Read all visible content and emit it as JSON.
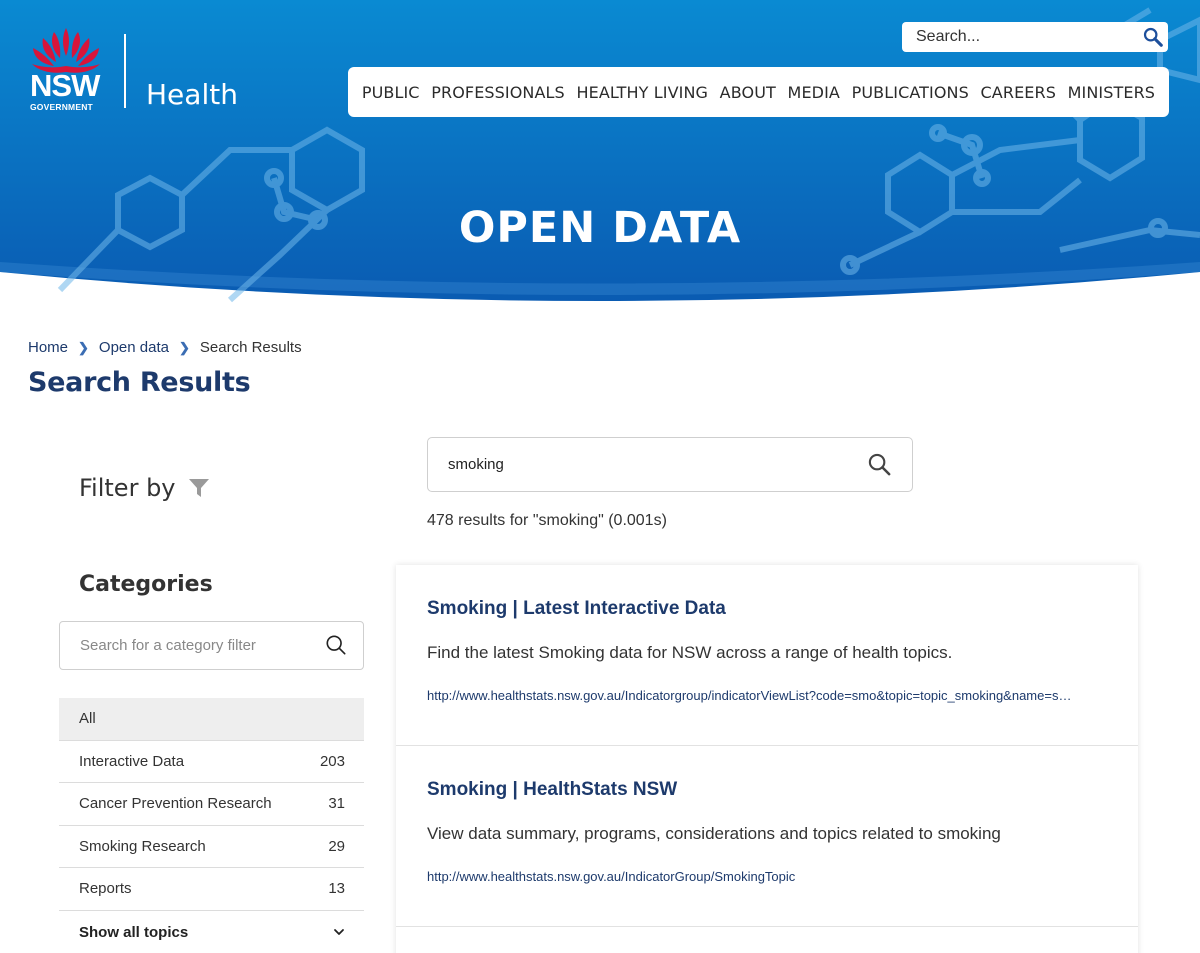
{
  "colors": {
    "banner_top": "#0a8ad2",
    "banner_bottom": "#0a5bb2",
    "brand_navy": "#1d3a6c",
    "waratah_red": "#d7153a"
  },
  "header": {
    "logo": {
      "wordmark": "NSW",
      "sub": "GOVERNMENT",
      "brand": "Health"
    },
    "search": {
      "placeholder": "Search...",
      "icon": "search-icon"
    },
    "nav": [
      "PUBLIC",
      "PROFESSIONALS",
      "HEALTHY LIVING",
      "ABOUT",
      "MEDIA",
      "PUBLICATIONS",
      "CAREERS",
      "MINISTERS"
    ],
    "banner_title": "OPEN DATA"
  },
  "breadcrumb": {
    "items": [
      "Home",
      "Open data"
    ],
    "current": "Search Results"
  },
  "page_title": "Search Results",
  "filter": {
    "heading": "Filter by",
    "icon": "filter-icon",
    "categories_heading": "Categories",
    "category_search_placeholder": "Search for a category filter",
    "categories": [
      {
        "label": "All",
        "count": ""
      },
      {
        "label": "Interactive Data",
        "count": "203"
      },
      {
        "label": "Cancer Prevention Research",
        "count": "31"
      },
      {
        "label": "Smoking Research",
        "count": "29"
      },
      {
        "label": "Reports",
        "count": "13"
      }
    ],
    "show_all": "Show all topics"
  },
  "search": {
    "query": "smoking",
    "summary": "478 results for \"smoking\" (0.001s)"
  },
  "results": [
    {
      "title": "Smoking | Latest Interactive Data",
      "description": "Find the latest Smoking data for NSW across a range of health topics.",
      "url": "http://www.healthstats.nsw.gov.au/Indicatorgroup/indicatorViewList?code=smo&topic=topic_smoking&name=smoking"
    },
    {
      "title": "Smoking | HealthStats NSW",
      "description": "View data summary, programs, considerations and topics related to smoking",
      "url": "http://www.healthstats.nsw.gov.au/IndicatorGroup/SmokingTopic"
    }
  ]
}
